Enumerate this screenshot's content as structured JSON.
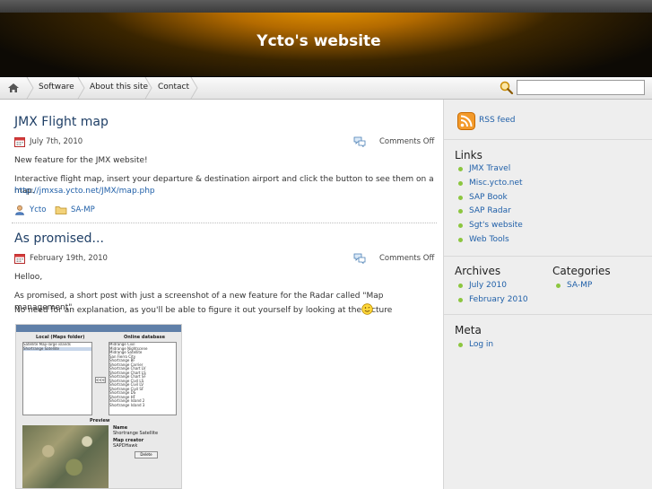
{
  "site": {
    "title": "Ycto's website"
  },
  "nav": {
    "items": [
      {
        "label": "Software"
      },
      {
        "label": "About this site"
      },
      {
        "label": "Contact"
      }
    ],
    "search_value": ""
  },
  "posts": [
    {
      "title": "JMX Flight map",
      "date": "July 7th, 2010",
      "comments": "Comments Off",
      "paragraphs": [
        "New feature for the JMX website!",
        "Interactive flight map, insert your departure & destination airport and click the button to see them on a map."
      ],
      "link": "http://jmxsa.ycto.net/JMX/map.php",
      "author": "Ycto",
      "category": "SA-MP"
    },
    {
      "title": "As promised...",
      "date": "February 19th, 2010",
      "comments": "Comments Off",
      "paragraphs": [
        "Helloo,",
        "As promised, a short post with just a screenshot of a new feature for the Radar called \"Map management\".",
        "No need for an explanation, as you'll be able to figure it out yourself by looking at the picture"
      ]
    }
  ],
  "screenshot": {
    "local_header": "Local (Maps folder)",
    "online_header": "Online database",
    "preview_header": "Preview",
    "local_items": [
      "Satellite Map-large islands",
      "Shortrange Satellite"
    ],
    "online_items": [
      "Midrange Civil",
      "Midrange Nightscene",
      "Midrange Satellite",
      "San Fierro City",
      "Shortrange BF",
      "Shortrange Carrier",
      "Shortrange Chart LV",
      "Shortrange Chart LS",
      "Shortrange Chart SF",
      "Shortrange Civil LS",
      "Shortrange Civil LV",
      "Shortrange Civil SF",
      "Shortrange DS",
      "Shortrange HF",
      "Shortrange Island 2",
      "Shortrange Island 3"
    ],
    "name_label": "Name",
    "name_value": "Shortrange Satellite",
    "creator_label": "Map creator",
    "creator_value": "SAPDHawk",
    "delete_label": "Delete",
    "arrow_label": "<<<"
  },
  "sidebar": {
    "rss": "RSS feed",
    "links_heading": "Links",
    "links": [
      "JMX Travel",
      "Misc.ycto.net",
      "SAP Book",
      "SAP Radar",
      "Sgt's website",
      "Web Tools"
    ],
    "archives_heading": "Archives",
    "archives": [
      "July 2010",
      "February 2010"
    ],
    "categories_heading": "Categories",
    "categories": [
      "SA-MP"
    ],
    "meta_heading": "Meta",
    "meta": [
      "Log in"
    ]
  },
  "colors": {
    "accent": "#f4a000",
    "link": "#1f5fa8",
    "bullet": "#8cc63f"
  }
}
